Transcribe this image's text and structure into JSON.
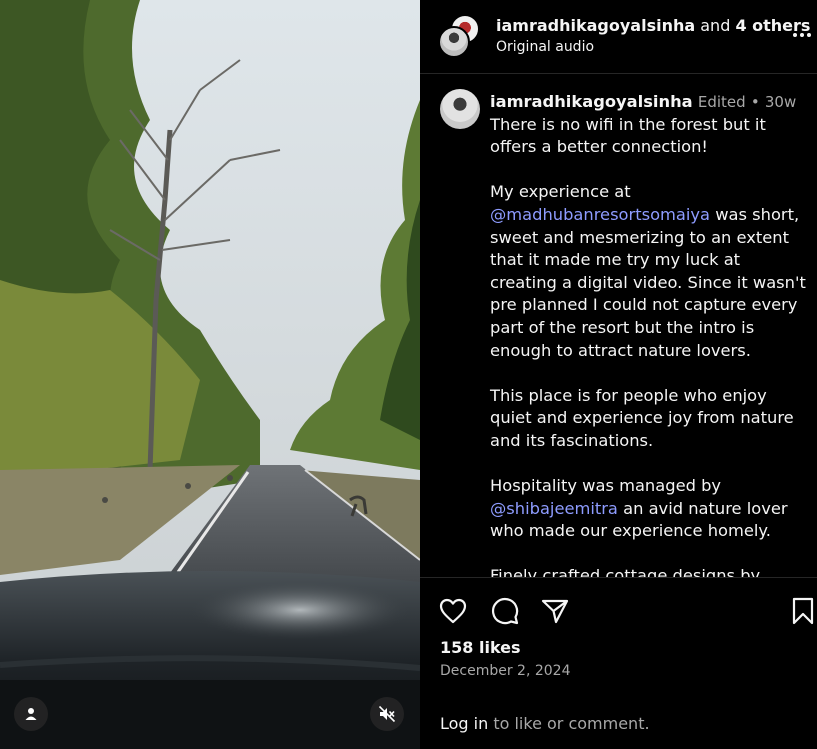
{
  "header": {
    "username": "iamradhikagoyalsinha",
    "and_text": " and ",
    "others_text": "4 others",
    "audio_label": "Original audio"
  },
  "caption": {
    "username": "iamradhikagoyalsinha",
    "edited_label": "Edited",
    "separator": "•",
    "age": "30w",
    "paragraphs": [
      "There is no wifi in the forest but it offers a better connection!",
      "was short, sweet and mesmerizing to an extent that it made me try my luck at creating a digital video. Since it wasn't pre planned I could not capture every part of the resort but the intro is enough to attract nature lovers.",
      "This place is for people who enjoy quiet and experience joy from nature and its fascinations.",
      "an avid nature lover who made our experience homely.",
      "Finely crafted cottage designs by"
    ],
    "prefix_2": "My experience at ",
    "mention_1": "@madhubanresortsomaiya",
    "prefix_4": "Hospitality was managed by ",
    "mention_2": "@shibajeemitra"
  },
  "actions": {
    "likes": "158 likes",
    "date": "December 2, 2024",
    "login_link": "Log in",
    "login_rest": " to like or comment."
  },
  "icons": {
    "like": "heart-icon",
    "comment": "comment-bubble-icon",
    "share": "paper-plane-icon",
    "save": "bookmark-icon",
    "more": "more-horizontal-icon",
    "user": "user-tag-icon",
    "mute": "speaker-muted-icon"
  }
}
